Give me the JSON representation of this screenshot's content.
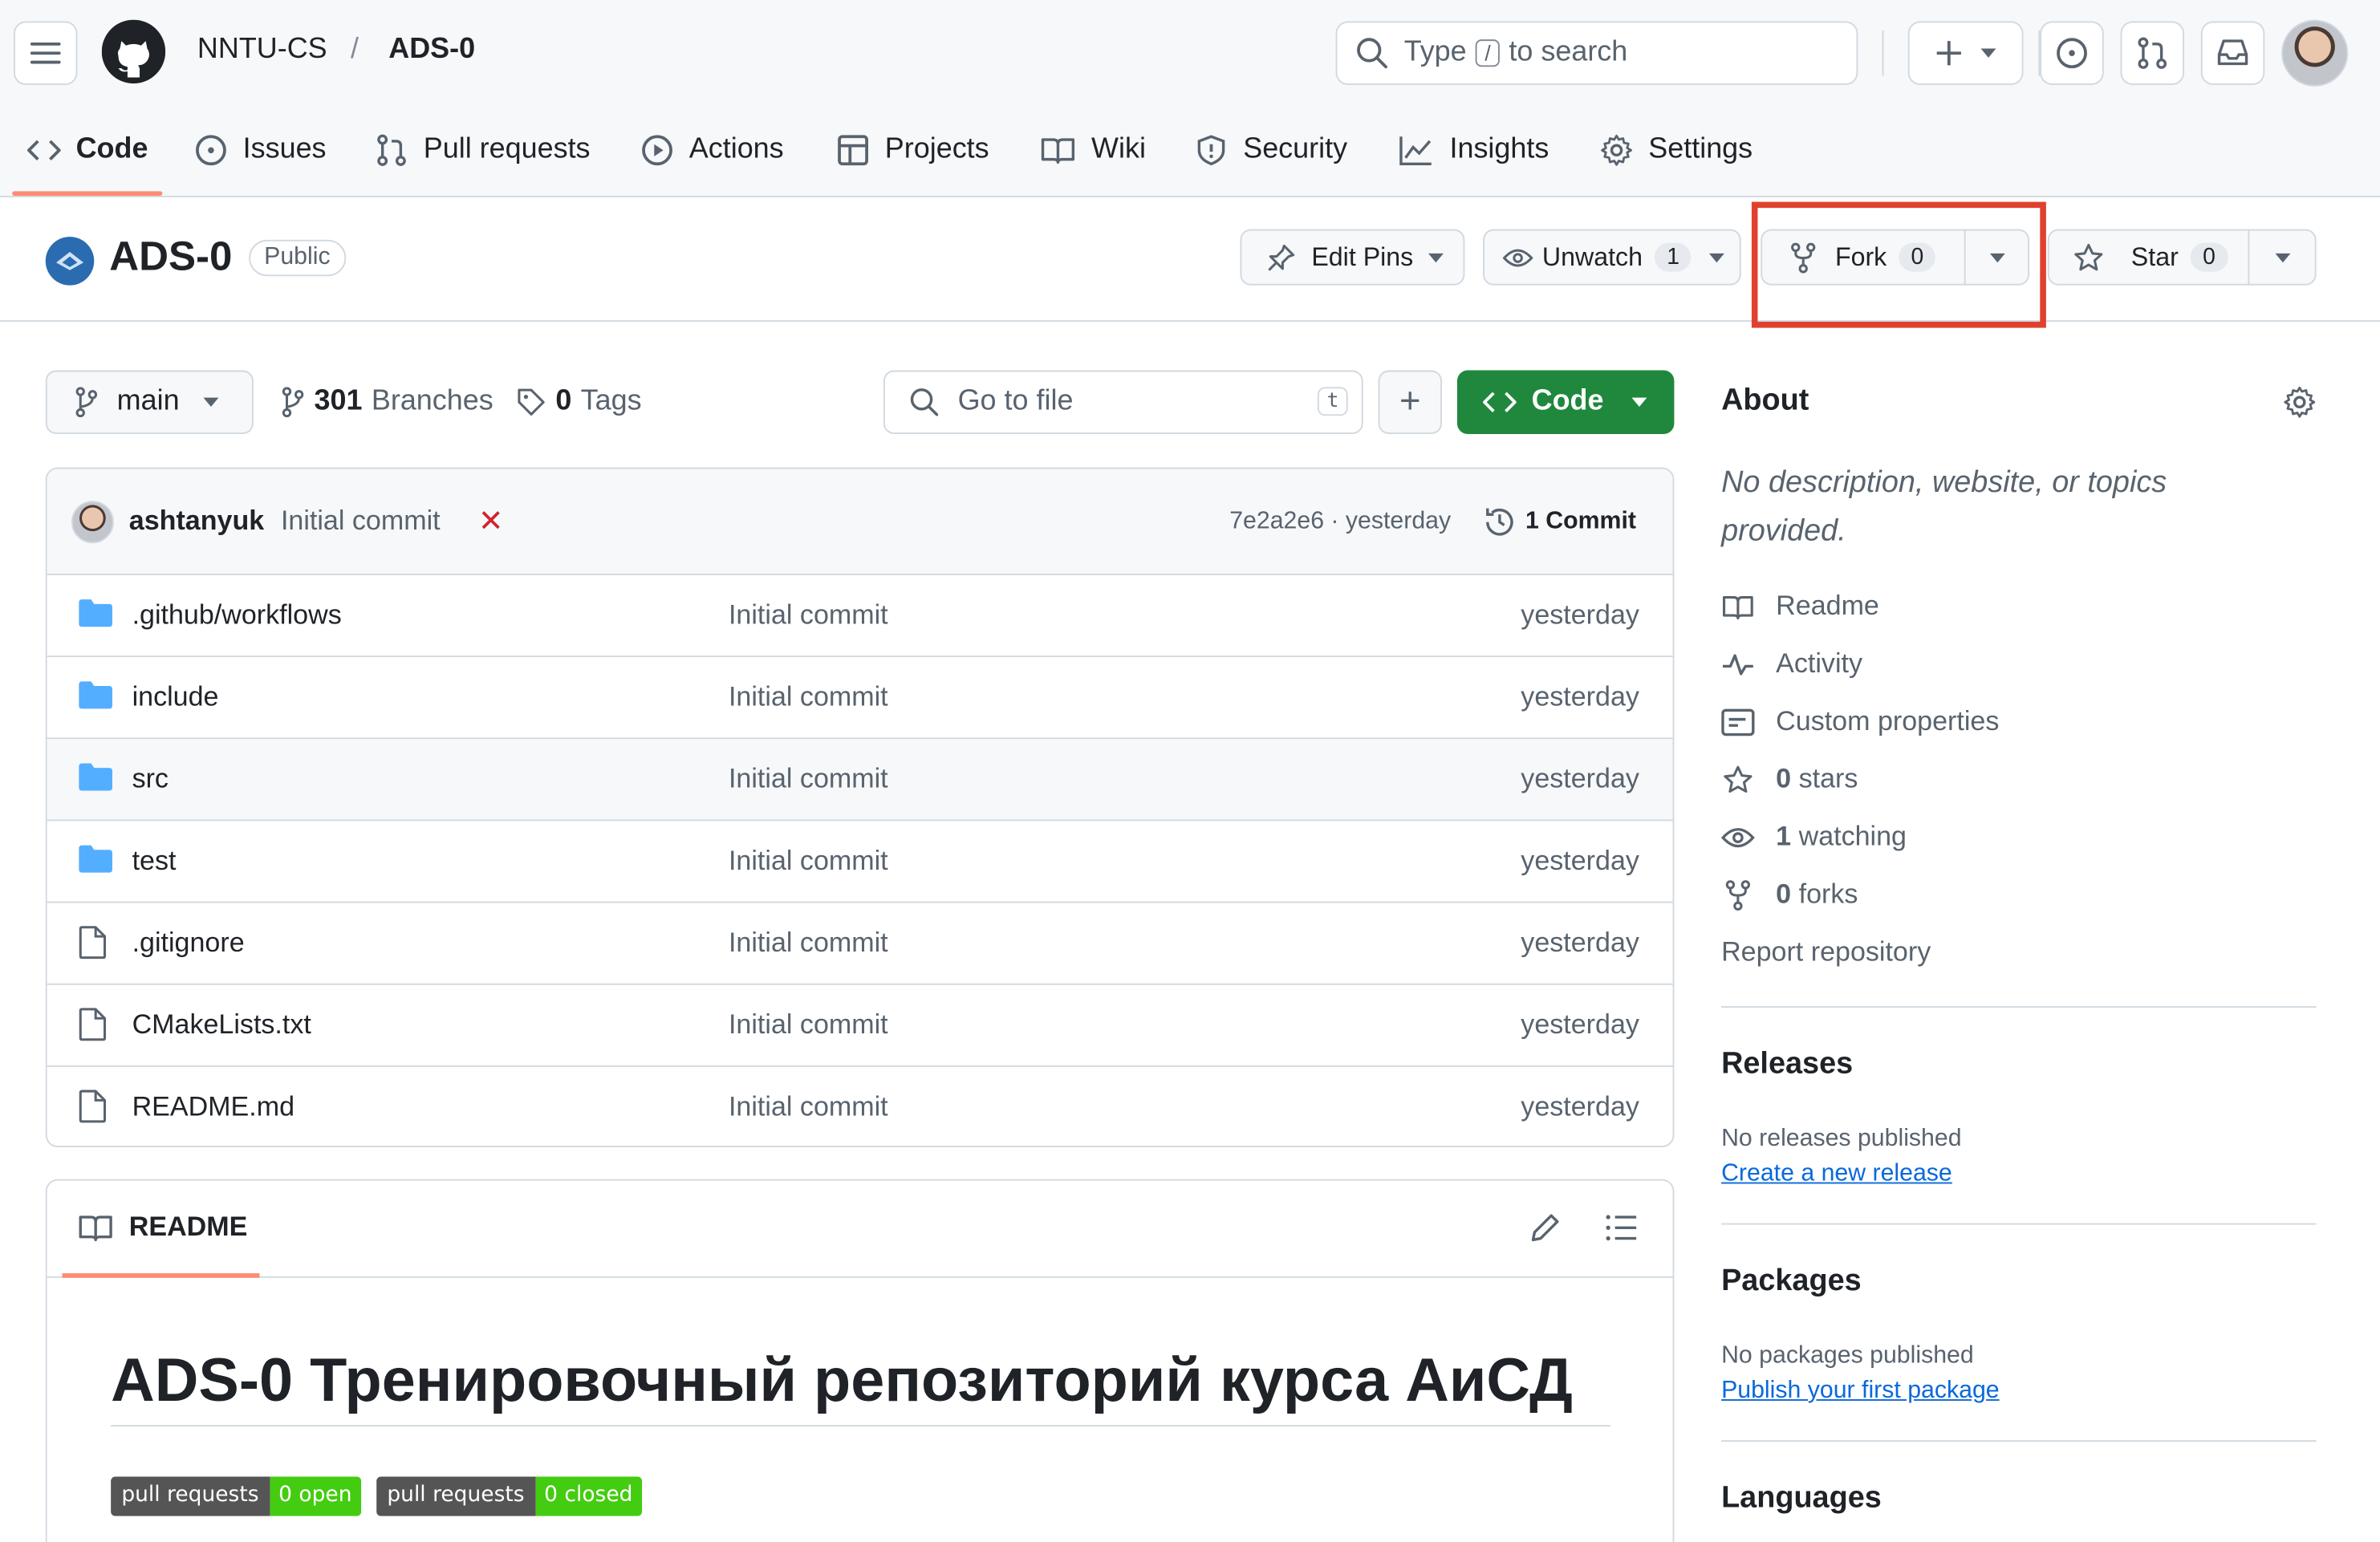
{
  "header": {
    "owner": "NNTU-CS",
    "separator": "/",
    "repo": "ADS-0",
    "search_prefix": "Type",
    "search_key": "/",
    "search_suffix": "to search"
  },
  "tabs": [
    {
      "label": "Code"
    },
    {
      "label": "Issues"
    },
    {
      "label": "Pull requests"
    },
    {
      "label": "Actions"
    },
    {
      "label": "Projects"
    },
    {
      "label": "Wiki"
    },
    {
      "label": "Security"
    },
    {
      "label": "Insights"
    },
    {
      "label": "Settings"
    }
  ],
  "repo_head": {
    "title": "ADS-0",
    "visibility": "Public",
    "edit_pins": "Edit Pins",
    "unwatch": "Unwatch",
    "unwatch_count": "1",
    "fork": "Fork",
    "fork_count": "0",
    "star": "Star",
    "star_count": "0"
  },
  "toolbar": {
    "branch": "main",
    "branches_count": "301",
    "branches_label": "Branches",
    "tags_count": "0",
    "tags_label": "Tags",
    "go_to_file": "Go to file",
    "go_to_file_key": "t",
    "add": "+",
    "code": "Code"
  },
  "commit": {
    "author": "ashtanyuk",
    "message": "Initial commit",
    "status": "✕",
    "sha_date": "7e2a2e6 · yesterday",
    "commits": "1 Commit"
  },
  "files": [
    {
      "name": ".github/workflows",
      "type": "folder",
      "message": "Initial commit",
      "date": "yesterday"
    },
    {
      "name": "include",
      "type": "folder",
      "message": "Initial commit",
      "date": "yesterday"
    },
    {
      "name": "src",
      "type": "folder",
      "message": "Initial commit",
      "date": "yesterday"
    },
    {
      "name": "test",
      "type": "folder",
      "message": "Initial commit",
      "date": "yesterday"
    },
    {
      "name": ".gitignore",
      "type": "file",
      "message": "Initial commit",
      "date": "yesterday"
    },
    {
      "name": "CMakeLists.txt",
      "type": "file",
      "message": "Initial commit",
      "date": "yesterday"
    },
    {
      "name": "README.md",
      "type": "file",
      "message": "Initial commit",
      "date": "yesterday"
    }
  ],
  "readme": {
    "tab": "README",
    "heading": "ADS-0 Тренировочный репозиторий курса АиСД",
    "badges": [
      {
        "label": "pull requests",
        "value": "0 open"
      },
      {
        "label": "pull requests",
        "value": "0 closed"
      }
    ]
  },
  "about": {
    "title": "About",
    "description": "No description, website, or topics provided.",
    "readme": "Readme",
    "activity": "Activity",
    "custom_properties": "Custom properties",
    "stars_count": "0",
    "stars_label": "stars",
    "watching_count": "1",
    "watching_label": "watching",
    "forks_count": "0",
    "forks_label": "forks",
    "report": "Report repository"
  },
  "releases": {
    "title": "Releases",
    "none": "No releases published",
    "link": "Create a new release"
  },
  "packages": {
    "title": "Packages",
    "none": "No packages published",
    "link": "Publish your first package"
  },
  "languages": {
    "title": "Languages"
  },
  "colors": {
    "accent_green": "#1f883d",
    "link_blue": "#0969da",
    "tab_underline": "#fd8c73",
    "highlight_box": "#e0412e",
    "error_red": "#d1242f"
  }
}
